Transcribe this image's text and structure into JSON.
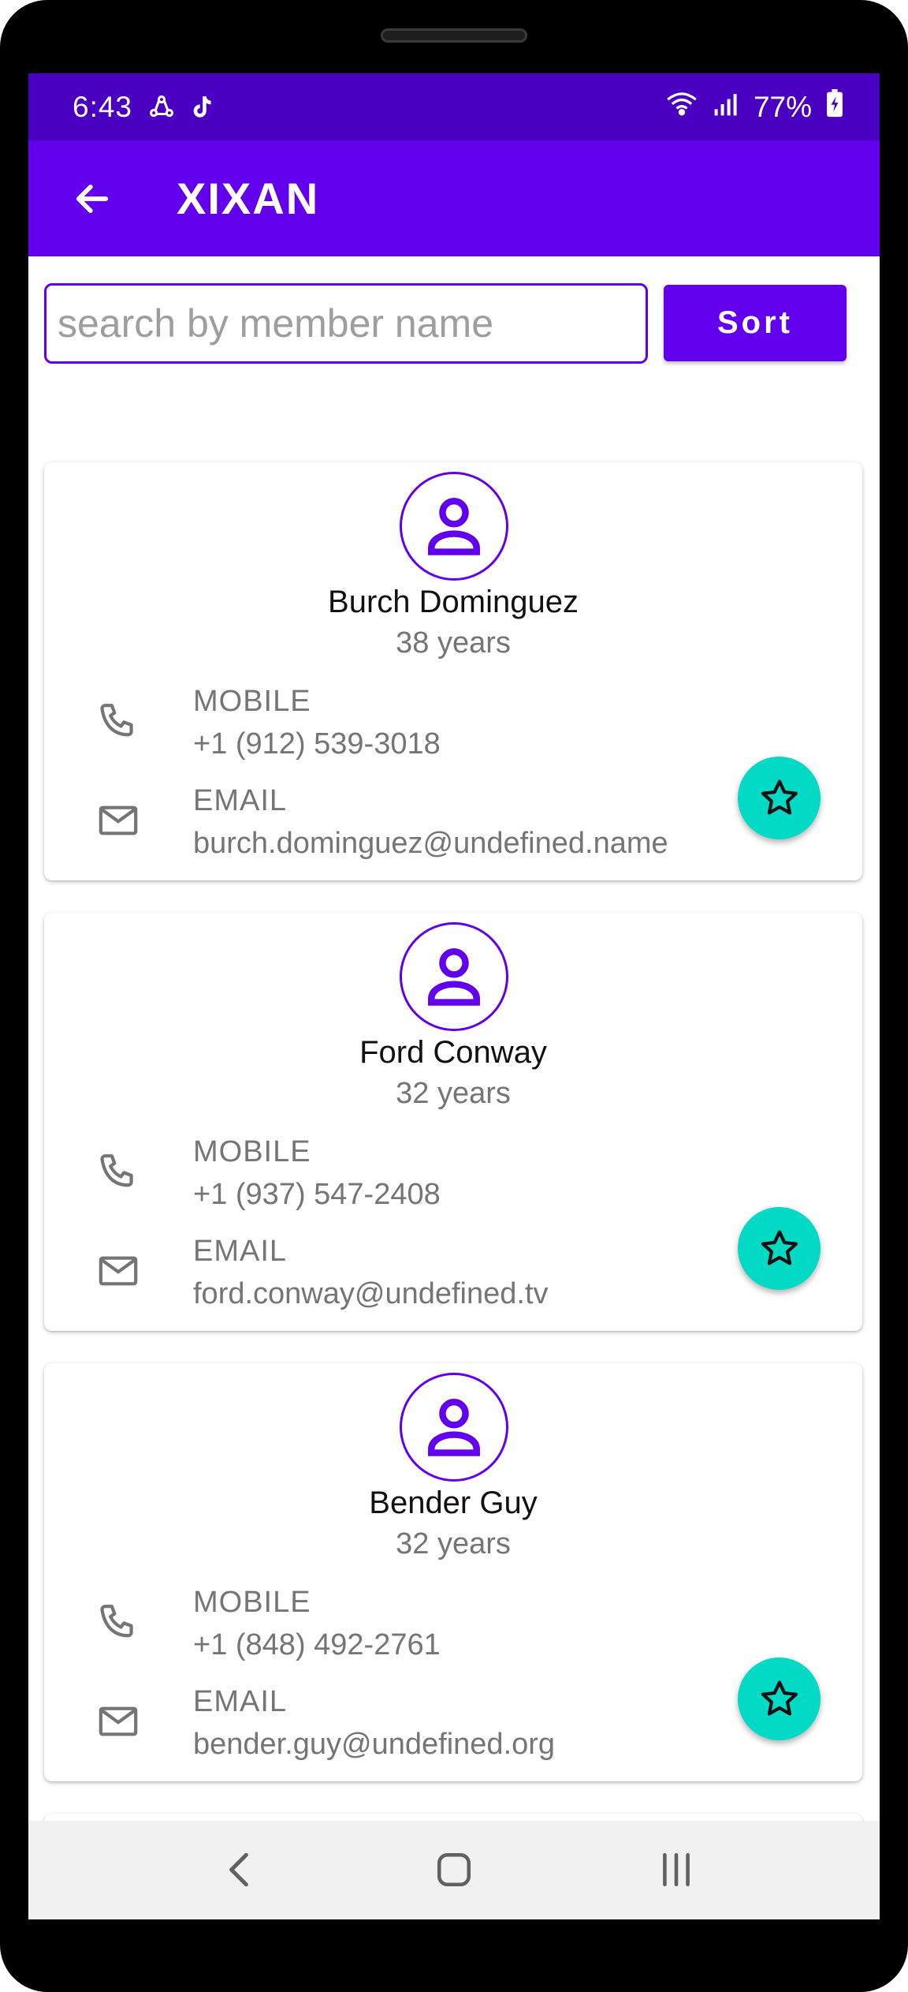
{
  "status_bar": {
    "time": "6:43",
    "battery": "77%"
  },
  "app_bar": {
    "title": "XIXAN"
  },
  "search": {
    "placeholder": "search by member name",
    "value": ""
  },
  "sort_label": "Sort",
  "members": [
    {
      "name": "Burch Dominguez",
      "age": "38 years",
      "mobile_label": "MOBILE",
      "mobile": "+1 (912) 539-3018",
      "email_label": "EMAIL",
      "email": "burch.dominguez@undefined.name"
    },
    {
      "name": "Ford Conway",
      "age": "32 years",
      "mobile_label": "MOBILE",
      "mobile": "+1 (937) 547-2408",
      "email_label": "EMAIL",
      "email": "ford.conway@undefined.tv"
    },
    {
      "name": "Bender Guy",
      "age": "32 years",
      "mobile_label": "MOBILE",
      "mobile": "+1 (848) 492-2761",
      "email_label": "EMAIL",
      "email": "bender.guy@undefined.org"
    }
  ],
  "colors": {
    "status_bar": "#4a00c0",
    "primary": "#6200ee",
    "fab": "#03dac5",
    "secondary_text": "#757575"
  },
  "icons": {
    "back": "arrow-left-icon",
    "avatar": "person-icon",
    "phone": "phone-icon",
    "email": "envelope-icon",
    "favorite": "star-outline-icon"
  }
}
